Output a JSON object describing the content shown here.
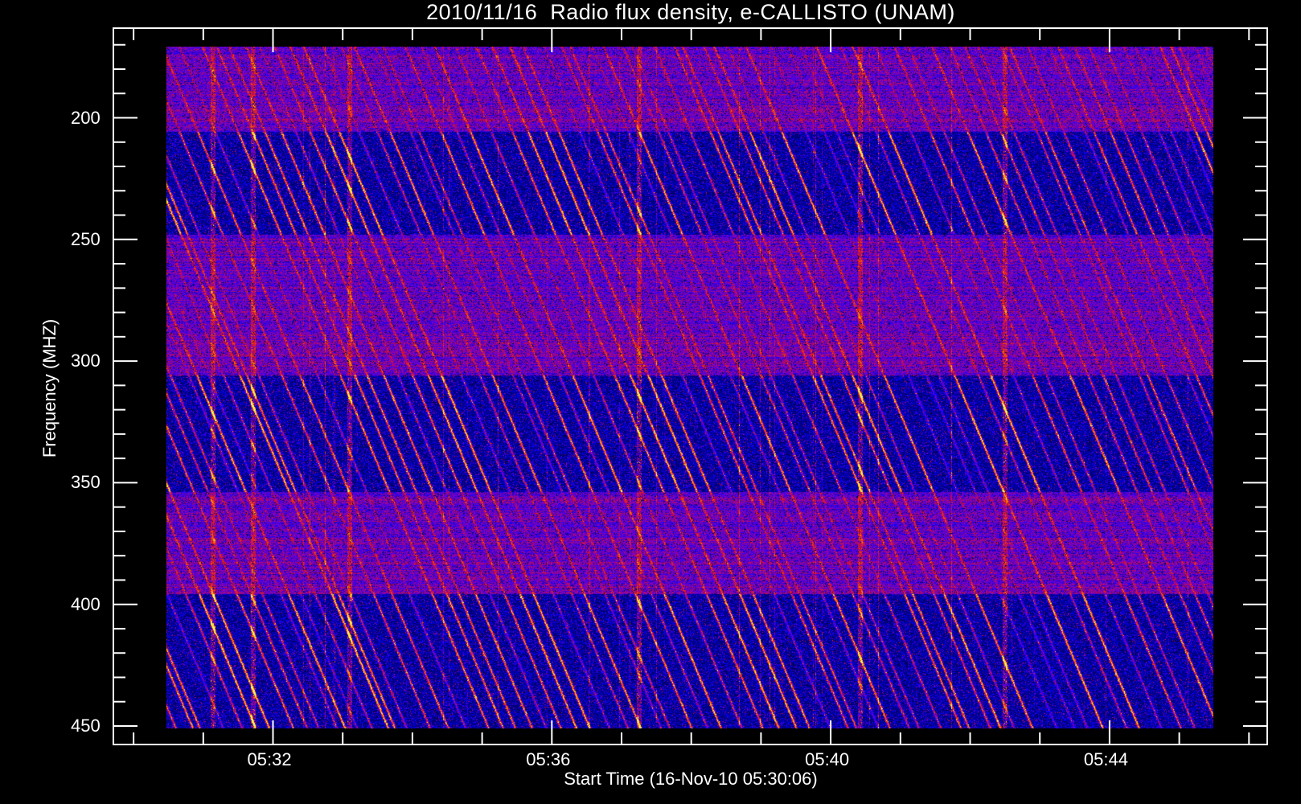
{
  "chart_data": {
    "type": "heatmap",
    "title": "2010/11/16  Radio flux density, e-CALLISTO (UNAM)",
    "xlabel": "Start Time (16-Nov-10 05:30:06)",
    "ylabel": "Frequency (MHZ)",
    "x_ticks": [
      "05:32",
      "05:36",
      "05:40",
      "05:44"
    ],
    "x_tick_minutes": [
      32,
      36,
      40,
      44
    ],
    "x_minor_step_minutes": 1,
    "y_ticks": [
      "200",
      "250",
      "300",
      "350",
      "400",
      "450"
    ],
    "y_tick_values": [
      200,
      250,
      300,
      350,
      400,
      450
    ],
    "y_minor_step": 10,
    "ylim": [
      171,
      450
    ],
    "y_inverted": true,
    "time_range_minutes": [
      30.8,
      45.8
    ],
    "grid": false,
    "colormap": [
      "#000000",
      "#0000ff",
      "#7800c8",
      "#e61414",
      "#ff8c00",
      "#ffff50"
    ],
    "features": "drifting bursts descending in frequency over time (type III-like stripes), noisy bands near 170-205, 250-305 and 355-395 MHz"
  }
}
